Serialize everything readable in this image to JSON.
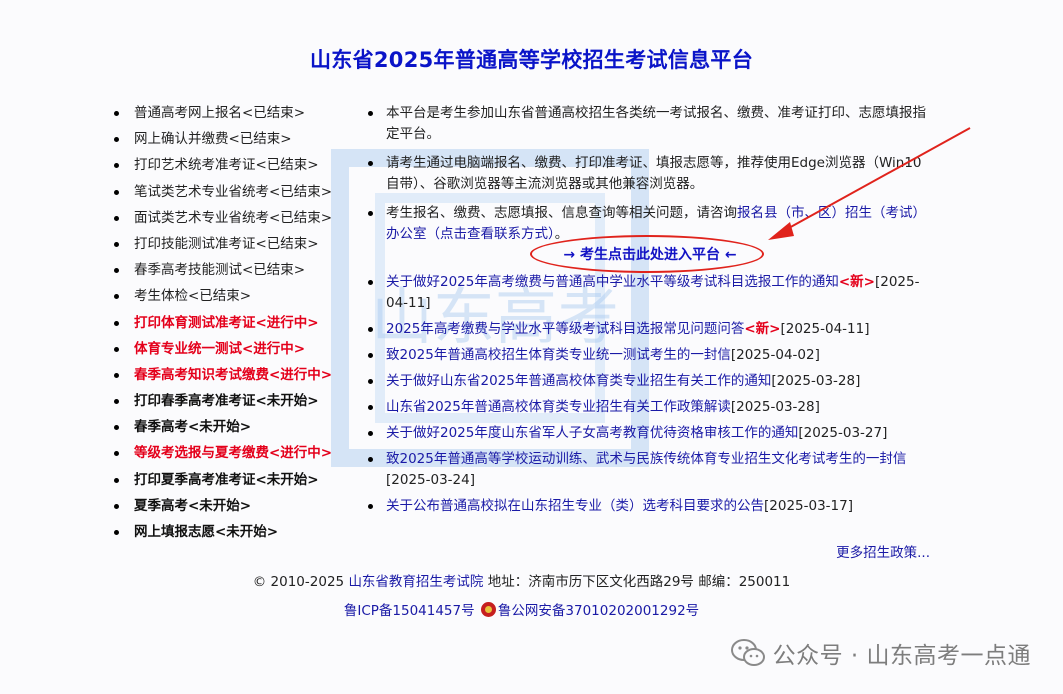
{
  "title": "山东省2025年普通高等学校招生考试信息平台",
  "watermark_text": "山东高考",
  "left_menu": [
    {
      "label": "普通高考网上报名<已结束>",
      "status": "done"
    },
    {
      "label": "网上确认并缴费<已结束>",
      "status": "done"
    },
    {
      "label": "打印艺术统考准考证<已结束>",
      "status": "done"
    },
    {
      "label": "笔试类艺术专业省统考<已结束>",
      "status": "done"
    },
    {
      "label": "面试类艺术专业省统考<已结束>",
      "status": "done"
    },
    {
      "label": "打印技能测试准考证<已结束>",
      "status": "done"
    },
    {
      "label": "春季高考技能测试<已结束>",
      "status": "done"
    },
    {
      "label": "考生体检<已结束>",
      "status": "done"
    },
    {
      "label": "打印体育测试准考证<进行中>",
      "status": "active"
    },
    {
      "label": "体育专业统一测试<进行中>",
      "status": "active"
    },
    {
      "label": "春季高考知识考试缴费<进行中>",
      "status": "active"
    },
    {
      "label": "打印春季高考准考证<未开始>",
      "status": "notstarted"
    },
    {
      "label": "春季高考<未开始>",
      "status": "notstarted"
    },
    {
      "label": "等级考选报与夏考缴费<进行中>",
      "status": "active"
    },
    {
      "label": "打印夏季高考准考证<未开始>",
      "status": "notstarted"
    },
    {
      "label": "夏季高考<未开始>",
      "status": "notstarted"
    },
    {
      "label": "网上填报志愿<未开始>",
      "status": "notstarted"
    }
  ],
  "info": {
    "line1": "本平台是考生参加山东省普通高校招生各类统一考试报名、缴费、准考证打印、志愿填报指定平台。",
    "line2": "请考生通过电脑端报名、缴费、打印准考证、填报志愿等，推荐使用Edge浏览器（Win10自带）、谷歌浏览器等主流浏览器或其他兼容浏览器。",
    "line3_prefix": "考生报名、缴费、志愿填报、信息查询等相关问题，请咨询",
    "line3_link": "报名县（市、区）招生（考试）办公室（点击查看联系方式）",
    "line3_suffix": "。"
  },
  "enter_button": "→ 考生点击此处进入平台 ←",
  "news": [
    {
      "title": "关于做好2025年高考缴费与普通高中学业水平等级考试科目选报工作的通知",
      "new": "<新>",
      "date": "[2025-04-11]"
    },
    {
      "title": "2025年高考缴费与学业水平等级考试科目选报常见问题问答",
      "new": "<新>",
      "date": "[2025-04-11]"
    },
    {
      "title": "致2025年普通高校招生体育类专业统一测试考生的一封信",
      "new": "",
      "date": "[2025-04-02]"
    },
    {
      "title": "关于做好山东省2025年普通高校体育类专业招生有关工作的通知",
      "new": "",
      "date": "[2025-03-28]"
    },
    {
      "title": "山东省2025年普通高校体育类专业招生有关工作政策解读",
      "new": "",
      "date": "[2025-03-28]"
    },
    {
      "title": "关于做好2025年度山东省军人子女高考教育优待资格审核工作的通知",
      "new": "",
      "date": "[2025-03-27]"
    },
    {
      "title": "致2025年普通高等学校运动训练、武术与民族传统体育专业招生文化考试考生的一封信",
      "new": "",
      "date": "[2025-03-24]"
    },
    {
      "title": "关于公布普通高校拟在山东招生专业（类）选考科目要求的公告",
      "new": "",
      "date": "[2025-03-17]"
    }
  ],
  "more": "更多招生政策...",
  "footer": {
    "copyright": "© 2010-2025",
    "org": "山东省教育招生考试院",
    "address": "地址：济南市历下区文化西路29号 邮编：250011",
    "icp": "鲁ICP备15041457号",
    "police": "鲁公网安备37010202001292号"
  },
  "wechat": "公众号 · 山东高考一点通",
  "colors": {
    "title": "#0a14c8",
    "link": "#1a1aa6",
    "active": "#e4001b",
    "annotation": "#e0231c"
  }
}
